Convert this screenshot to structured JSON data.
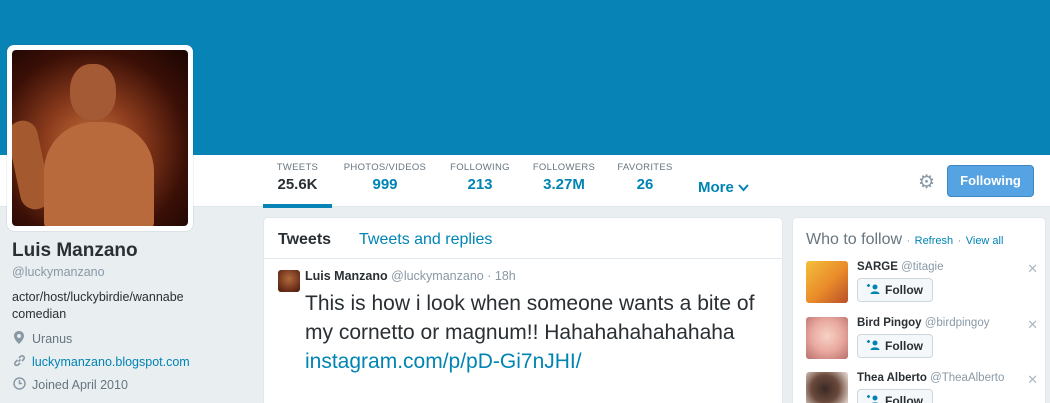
{
  "profile": {
    "name": "Luis Manzano",
    "handle": "@luckymanzano",
    "bio": "actor/host/luckybirdie/wannabe comedian",
    "location": "Uranus",
    "website": "luckymanzano.blogspot.com",
    "joined": "Joined April 2010"
  },
  "stats": [
    {
      "label": "TWEETS",
      "value": "25.6K"
    },
    {
      "label": "PHOTOS/VIDEOS",
      "value": "999"
    },
    {
      "label": "FOLLOWING",
      "value": "213"
    },
    {
      "label": "FOLLOWERS",
      "value": "3.27M"
    },
    {
      "label": "FAVORITES",
      "value": "26"
    }
  ],
  "nav": {
    "more_label": "More",
    "follow_state": "Following"
  },
  "timeline": {
    "tabs": [
      "Tweets",
      "Tweets and replies"
    ],
    "tweet": {
      "name": "Luis Manzano",
      "handle": "@luckymanzano",
      "separator": "·",
      "time": "18h",
      "text": "This is how i look when someone wants a bite of my cornetto or magnum!! Hahahahahahahaha",
      "link": "instagram.com/p/pD-Gi7nJHI/"
    }
  },
  "who_to_follow": {
    "title": "Who to follow",
    "separator": "·",
    "refresh": "Refresh",
    "view_all": "View all",
    "follow_label": "Follow",
    "suggestions": [
      {
        "name": "SARGE",
        "handle": "@titagie"
      },
      {
        "name": "Bird Pingoy",
        "handle": "@birdpingoy"
      },
      {
        "name": "Thea Alberto",
        "handle": "@TheaAlberto"
      }
    ]
  },
  "colors": {
    "banner": "#0784b5",
    "link": "#0084b4",
    "following_button": "#56a3e4"
  },
  "icons": {
    "location": "map-pin-icon",
    "website": "link-icon",
    "joined": "clock-icon",
    "settings": "gear-icon",
    "more": "chevron-down-icon",
    "follow": "add-user-icon",
    "dismiss": "close-icon"
  }
}
